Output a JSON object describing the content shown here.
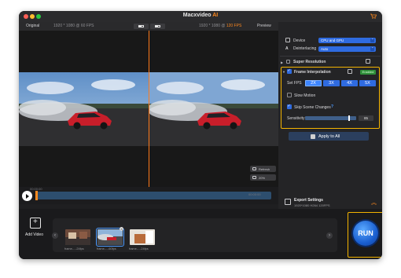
{
  "app": {
    "title": "Macxvideo",
    "title_accent": "AI"
  },
  "preview_header": {
    "original_label": "Original",
    "left_resolution": "1920 * 1080 @ 60 FPS",
    "right_resolution": "1920 * 1080 @",
    "right_fps": "120 FPS",
    "preview_label": "Preview"
  },
  "preview_tools": {
    "refresh_label": "Refresh",
    "zoom_label": "20%"
  },
  "timeline": {
    "current_time": "00:00:00",
    "end_time": "00:00:00"
  },
  "panel": {
    "device": {
      "label": "Device",
      "value": "CPU and GPU"
    },
    "deinterlacing": {
      "label": "Deinterlacing",
      "value": "Auto"
    },
    "super_resolution": {
      "label": "Super Resolution"
    },
    "frame_interpolation": {
      "label": "Frame Interpolation",
      "badge": "Enabled",
      "set_fps_label": "Set FPS",
      "fps_options": [
        "2X",
        "3X",
        "4X",
        "5X"
      ],
      "selected": "2X",
      "slow_motion_label": "Slow Motion",
      "skip_scene_label": "Skip Scene Changes",
      "help": "?",
      "sensitivity_label": "Sensitivity",
      "sensitivity_value": "85",
      "sensitivity_level": 0.85
    },
    "apply_label": "Apply to All",
    "export": {
      "title": "Export Settings",
      "subtitle": "1920*1080 H264 120FPS"
    }
  },
  "bottom": {
    "add_video_label": "Add Video",
    "thumbnails": [
      {
        "label": "frame-...-24fps"
      },
      {
        "label": "frame-...-60fps"
      },
      {
        "label": "frame-...-24fps"
      }
    ],
    "run_label": "RUN"
  },
  "colors": {
    "accent": "#ff8a1f",
    "primary": "#2f6be0",
    "highlight": "#f4b400"
  }
}
